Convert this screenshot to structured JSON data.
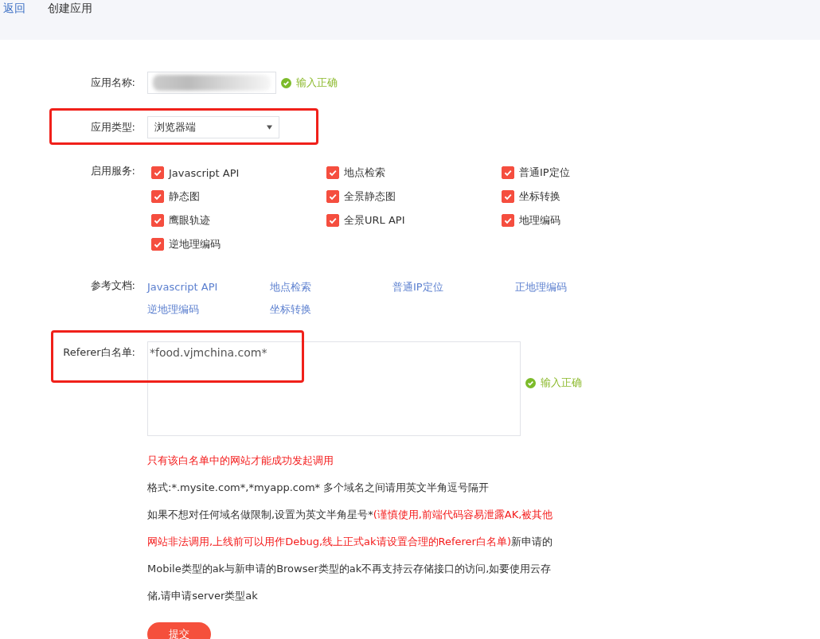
{
  "breadcrumb": {
    "back_link": "返回",
    "title": "创建应用"
  },
  "app_name": {
    "label": "应用名称:",
    "valid": true,
    "status": "输入正确"
  },
  "app_type": {
    "label": "应用类型:",
    "value": "浏览器端",
    "annotated": true
  },
  "services": {
    "label": "启用服务:",
    "items": [
      {
        "label": "Javascript API",
        "checked": true
      },
      {
        "label": "地点检索",
        "checked": true
      },
      {
        "label": "普通IP定位",
        "checked": true
      },
      {
        "label": "静态图",
        "checked": true
      },
      {
        "label": "全景静态图",
        "checked": true
      },
      {
        "label": "坐标转换",
        "checked": true
      },
      {
        "label": "鹰眼轨迹",
        "checked": true
      },
      {
        "label": "全景URL API",
        "checked": true
      },
      {
        "label": "地理编码",
        "checked": true
      },
      {
        "label": "逆地理编码",
        "checked": true
      }
    ]
  },
  "docs": {
    "label": "参考文档:",
    "links": [
      "Javascript API",
      "地点检索",
      "普通IP定位",
      "正地理编码",
      "逆地理编码",
      "坐标转换"
    ]
  },
  "referer": {
    "label": "Referer白名单:",
    "value": "*food.vjmchina.com*",
    "valid": true,
    "status": "输入正确",
    "annotated": true
  },
  "notes": [
    {
      "segments": [
        {
          "text": "只有该白名单中的网站才能成功发起调用",
          "warning": true
        }
      ]
    },
    {
      "segments": [
        {
          "text": "格式:*.mysite.com*,*myapp.com* 多个域名之间请用英文半角逗号隔开",
          "warning": false
        }
      ]
    },
    {
      "segments": [
        {
          "text": "如果不想对任何域名做限制,设置为英文半角星号*",
          "warning": false
        },
        {
          "text": "(谨慎使用,前端代码容易泄露AK,被其他网站非法调用,上线前可以用作Debug,线上正式ak请设置合理的Referer白名单)",
          "warning": true
        },
        {
          "text": "新申请的Mobile类型的ak与新申请的Browser类型的ak不再支持云存储接口的访问,如要使用云存储,请申请server类型ak",
          "warning": false
        }
      ]
    }
  ],
  "submit": "提交"
}
